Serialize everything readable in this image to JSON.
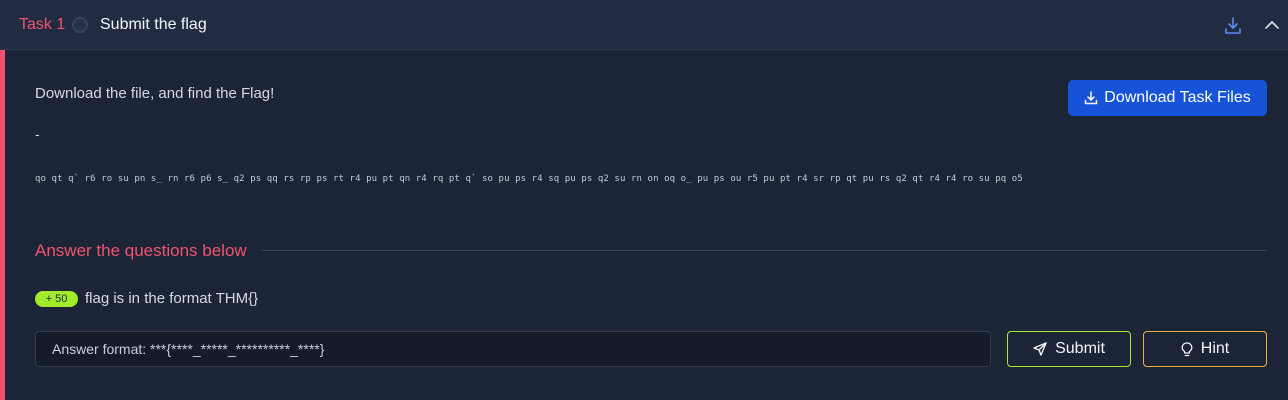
{
  "header": {
    "task_number": "Task 1",
    "task_title": "Submit the flag",
    "download_icon": "download-icon",
    "collapse_icon": "chevron-up-icon"
  },
  "task": {
    "description": "Download the file, and find the Flag!",
    "separator": "-",
    "cipher_text": "qo qt q` r6 ro su pn s_ rn r6 p6 s_ q2 ps qq rs rp ps rt r4 pu pt qn r4 rq pt q` so pu ps r4 sq pu ps q2 su rn on oq o_ pu ps ou r5 pu pt r4 sr rp qt pu rs q2 qt r4 r4 ro su pq o5",
    "download_button_label": "Download Task Files"
  },
  "questions_section": {
    "heading": "Answer the questions below",
    "question": {
      "points": "+ 50",
      "text": "flag is in the format THM{}",
      "placeholder": "Answer format: ***{****_*****_**********_****}",
      "submit_label": "Submit",
      "hint_label": "Hint"
    }
  },
  "colors": {
    "accent": "#f0536d",
    "primary_button": "#1653d9",
    "points_badge": "#a3ea2a",
    "hint_border": "#f0b03a"
  }
}
